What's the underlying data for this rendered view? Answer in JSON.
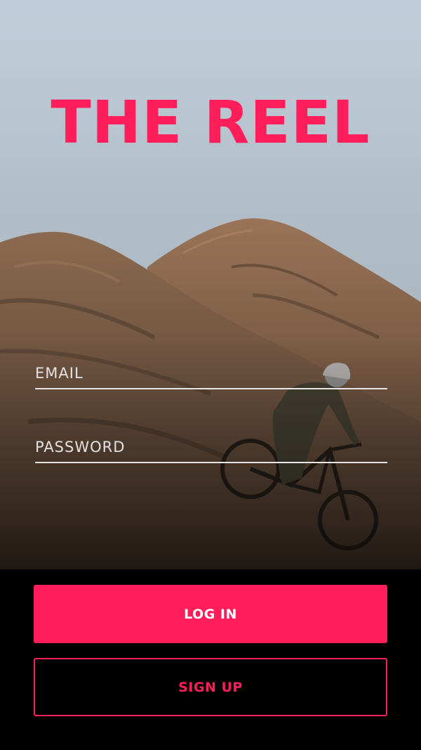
{
  "app": {
    "title": "THE REEL"
  },
  "form": {
    "email_placeholder": "EMAIL",
    "email_value": "",
    "password_placeholder": "PASSWORD",
    "password_value": ""
  },
  "actions": {
    "login_label": "LOG IN",
    "signup_label": "SIGN UP"
  },
  "colors": {
    "accent": "#ff1e5a",
    "background": "#000000",
    "field_underline": "#e6e6e6",
    "placeholder": "#e2e2e2"
  },
  "icons": {
    "background_image": "mountain-biker-desert-hills-photo"
  }
}
